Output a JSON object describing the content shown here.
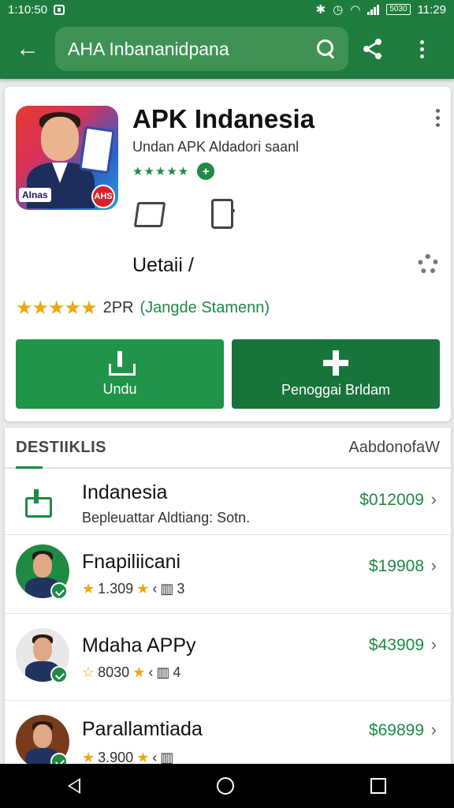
{
  "status_bar": {
    "time_left": "1:10:50",
    "time_right": "11:29",
    "battery": "5030"
  },
  "search": {
    "query": "AHA Inbananidpana"
  },
  "app": {
    "title": "APK Indanesia",
    "developer": "Undan APK Aldadori saanl",
    "green_stars": "★★★★★",
    "verified_glyph": "+",
    "icon_label": "AInas",
    "icon_badge": "AHS",
    "detail_label": "Uetaii /",
    "gold_stars": "★★★★★",
    "rating_count": "2PR",
    "rating_note": "(Jangde Stamenn)",
    "download_label": "Undu",
    "add_label": "Penoggai Brldam"
  },
  "list": {
    "tab_label": "DESTIIKLIS",
    "see_all_label": "AabdonofaW",
    "rows": [
      {
        "name": "Indanesia",
        "subtitle": "Bepleuattar Aldtiang: Sotn.",
        "price": "$012009"
      },
      {
        "name": "Fnapiliicani",
        "rating": "1.309",
        "count": "3",
        "price": "$19908"
      },
      {
        "name": "Mdaha APPy",
        "rating": "8030",
        "count": "4",
        "price": "$43909"
      },
      {
        "name": "Parallamtiada",
        "rating": "3.900",
        "count": "",
        "price": "$69899"
      }
    ]
  },
  "colors": {
    "brand_green": "#1e7d3e",
    "accent_green": "#1e8a44",
    "star_gold": "#f2a60c"
  }
}
